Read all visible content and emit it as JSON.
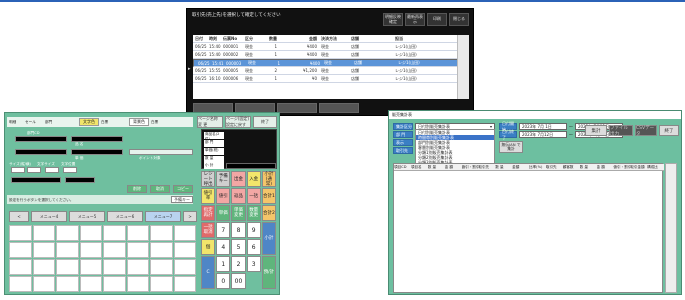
{
  "top_window": {
    "message": "取引先(売上先)を選択して確定してください",
    "buttons": [
      "明細反映\n確定",
      "最新再表示",
      "印刷",
      "閉じる"
    ],
    "columns": [
      "日付",
      "時刻",
      "伝票No",
      "区分",
      "数量",
      "金額",
      "決済方法",
      "店舗",
      "担当"
    ],
    "rows": [
      [
        "06/25",
        "15:40",
        "000001",
        "現金",
        "1",
        "¥400",
        "現金",
        "店舗",
        "レジ1(山田)"
      ],
      [
        "06/25",
        "15:40",
        "000002",
        "現金",
        "1",
        "¥400",
        "現金",
        "店舗",
        "レジ1(山田)"
      ],
      [
        "06/25",
        "15:41",
        "000003",
        "現金",
        "1",
        "¥400",
        "現金",
        "店舗",
        "レジ1(山田)"
      ],
      [
        "06/25",
        "15:48",
        "000004",
        "現金",
        "1",
        "¥400",
        "現金",
        "店舗",
        "レジ1(山田)"
      ],
      [
        "06/25",
        "15:55",
        "000005",
        "現金",
        "2",
        "¥1,200",
        "現金",
        "店舗",
        "レジ1(山田)"
      ],
      [
        "06/25",
        "16:10",
        "000006",
        "現金",
        "1",
        "¥0",
        "現金",
        "店舗",
        "レジ1(山田)"
      ]
    ],
    "selected_row": 2
  },
  "left_window": {
    "radio_group": [
      "明細",
      "セール",
      "部門"
    ],
    "chips": [
      "文字色",
      "白黒",
      "背景色",
      "白黒"
    ],
    "fields": [
      "部門CD",
      "品 名",
      "単 価",
      "ポイント対象"
    ],
    "size_labels": [
      "サイズ(縦/横)",
      "文字サイズ",
      "文字位置"
    ],
    "bottom_label": "画面ボタン",
    "right_buttons": [
      "ページ名称\n変 更",
      "ページ(固定)\n設定に戻す",
      "終了"
    ],
    "mode_buttons": [
      "削除",
      "取消",
      "コピー"
    ],
    "info_title": "商品名(2件)",
    "info_rows": [
      "部 門",
      "単価(税)",
      "数 量",
      "小 計"
    ],
    "nav_buttons": [
      "<",
      "メニュー4",
      "メニュー5",
      "メニュー6",
      "メニュー7",
      ">"
    ],
    "note": "設定を行うボタンを選択してください。",
    "keypad": [
      [
        "レシート\n呼出",
        "予備\nキー",
        "出金",
        "入金",
        "小計\n(通常)"
      ],
      [
        "値引率",
        "値引",
        "返品",
        "一括",
        "合計1"
      ],
      [
        "指定\n再計",
        "単価",
        "単価\n変更",
        "数量\n変更",
        "合計2"
      ],
      [
        "一括\n取消",
        "7",
        "8",
        "9",
        "小計"
      ],
      [
        "個",
        "4",
        "5",
        "6",
        ""
      ],
      [
        "C",
        "1",
        "2",
        "3",
        "預/計"
      ],
      [
        "",
        "0",
        "00",
        "",
        ""
      ]
    ]
  },
  "right_window": {
    "title": "販売集計表",
    "left_labels": [
      "集計区分",
      "部 門",
      "表示",
      "取引先"
    ],
    "report_select": "日付別販売集計表",
    "report_options": [
      "日付別販売集計表",
      "時間帯別販売集計表",
      "部門別販売集計表",
      "客層別販売集計表",
      "分類1別販売集計表",
      "分類2別販売集計表",
      "分類3別販売集計表",
      "担当者別販売集計表",
      "取引先別販売集計表"
    ],
    "date_from_label": "日付開始",
    "date_to_label": "日付終了",
    "date_from": "2023年 7月 1日",
    "date_to": "2023年 7月12日",
    "tilde1": "～",
    "tilde2": "～",
    "date_end_1": "2023年 7月12日",
    "date_end_2": "2023年 7月12日",
    "janbutton": "無伝JAN\nで集計",
    "top_buttons": [
      "集計",
      "ファイル出力",
      "CSVデータ",
      "終了"
    ],
    "grid_headers": [
      "項目CD",
      "項目名",
      "数 量",
      "金 額",
      "値引・割引",
      "取引先",
      "数 量",
      "金額",
      "比率(%)",
      "取引先",
      "顧客数",
      "数 量",
      "金 額",
      "値引・割引",
      "取引金額",
      "構成比"
    ]
  }
}
